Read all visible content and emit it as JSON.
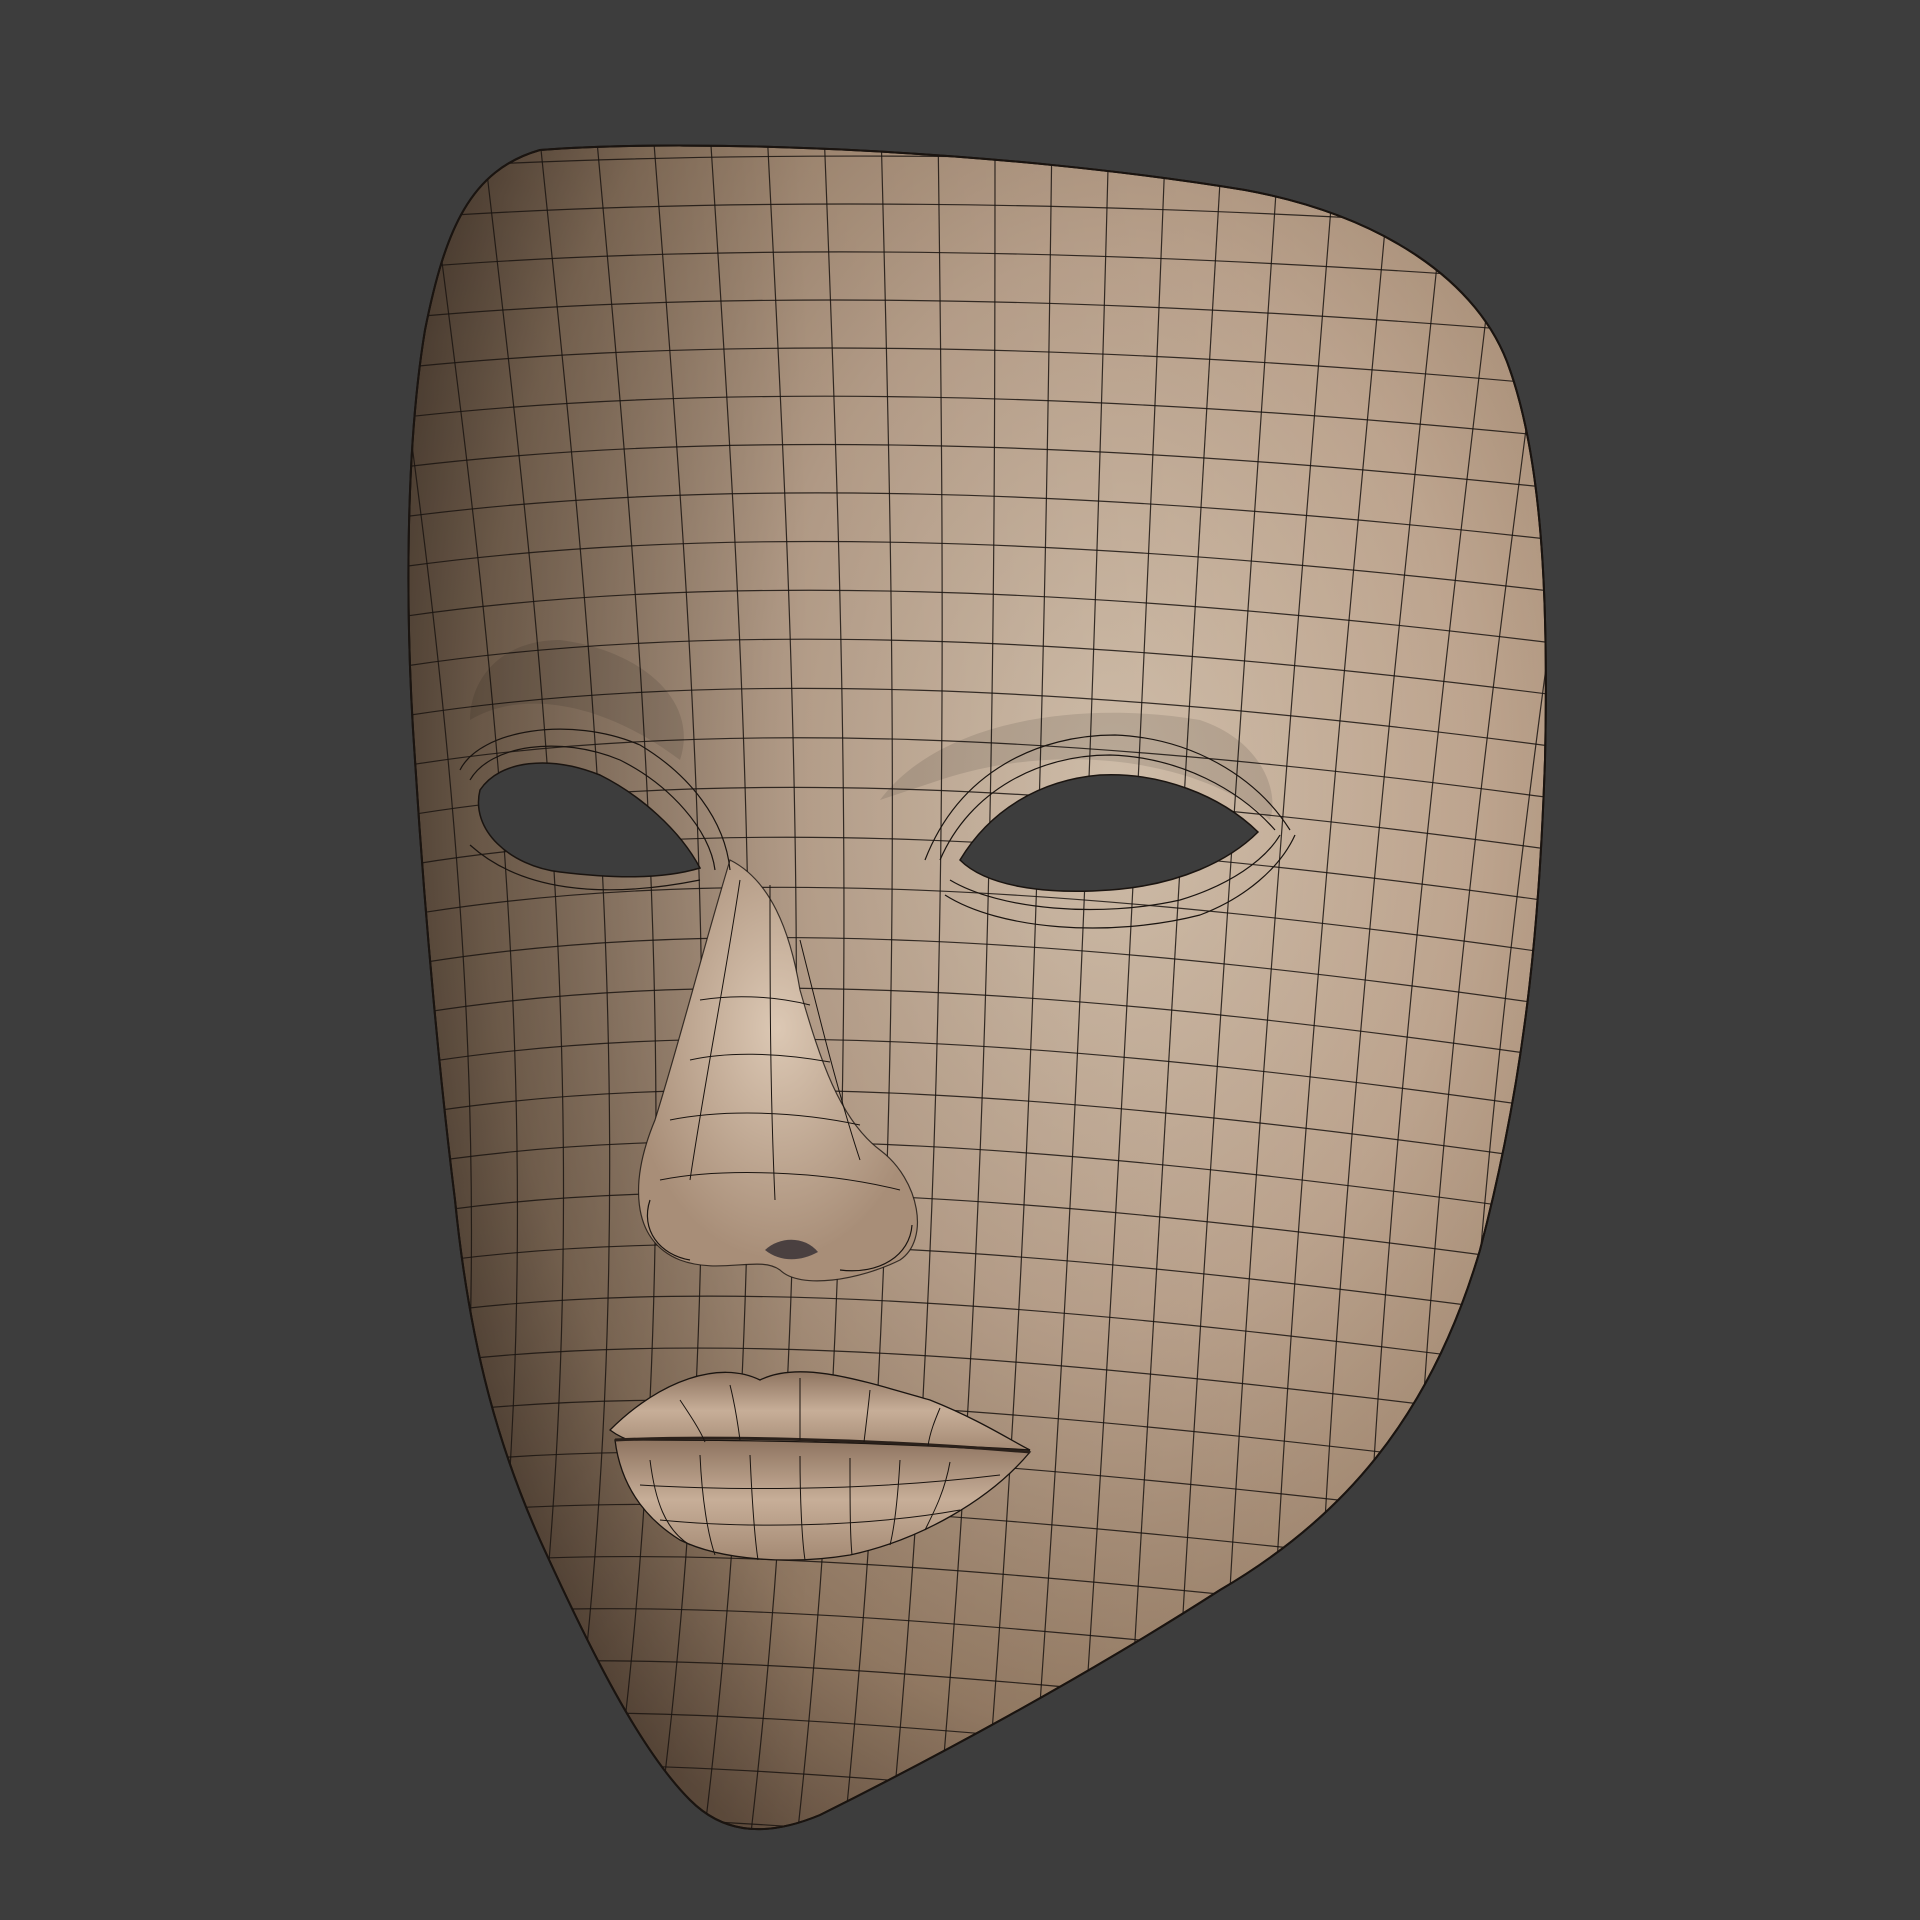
{
  "scene": {
    "subject": "face-mask-mesh",
    "shading": "matcap-clay",
    "wireframe_overlay": true
  },
  "colors": {
    "background": "#3d3d3d",
    "clay_light": "#d6c2ac",
    "clay_mid": "#b09680",
    "clay_dark": "#6e5a48",
    "wire": "#1a1410"
  }
}
